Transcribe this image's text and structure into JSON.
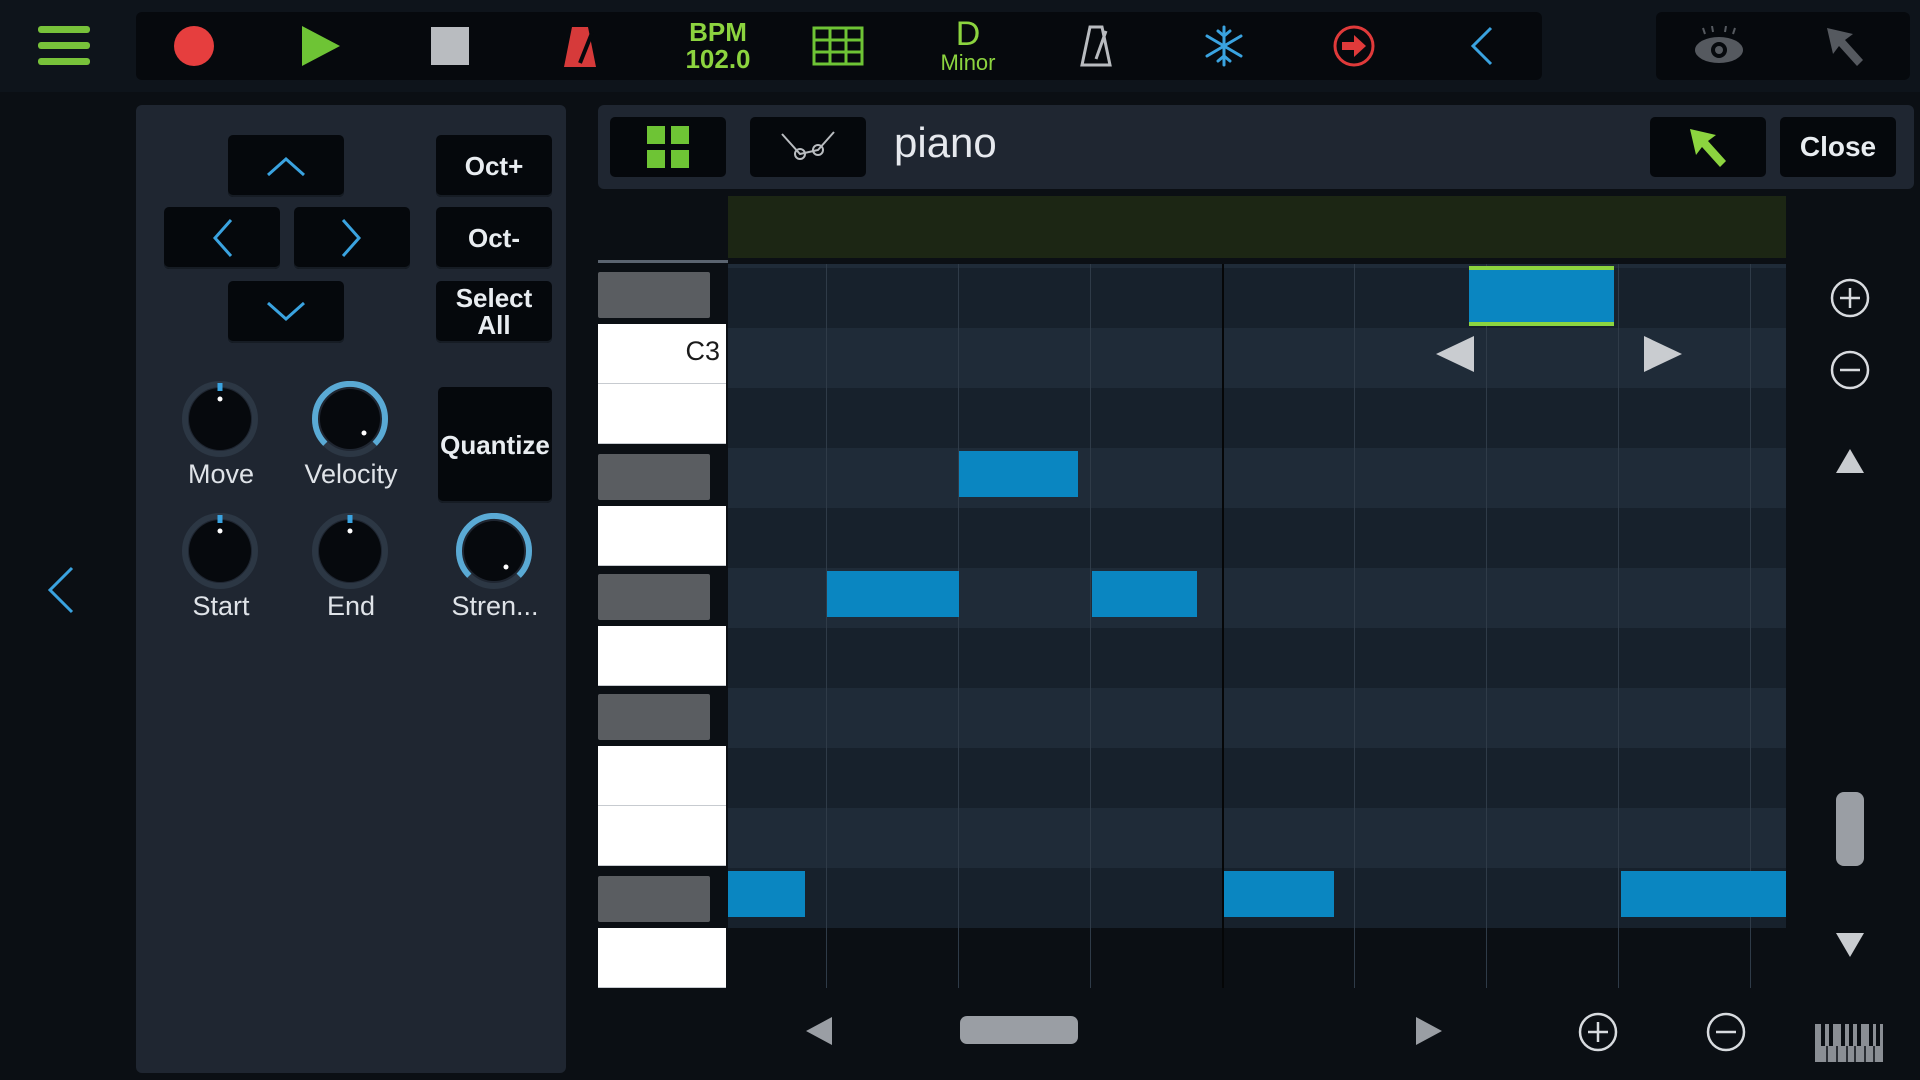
{
  "toolbar": {
    "bpm_label": "BPM",
    "bpm_value": "102.0",
    "key_root": "D",
    "key_mode": "Minor"
  },
  "edit_panel": {
    "oct_up": "Oct+",
    "oct_down": "Oct-",
    "select_all_line1": "Select",
    "select_all_line2": "All",
    "quantize": "Quantize",
    "knobs": {
      "move": "Move",
      "velocity": "Velocity",
      "start": "Start",
      "end": "End",
      "strength": "Stren..."
    }
  },
  "editor": {
    "instrument_name": "piano",
    "close_label": "Close",
    "note_label": "C3"
  },
  "colors": {
    "accent_green": "#8cd43f",
    "note_blue": "#0a86c1",
    "record_red": "#e63e3e",
    "icon_blue": "#3aa3e0"
  },
  "piano_roll": {
    "rows": 11,
    "notes": [
      {
        "row": 1,
        "start_beat": 5.6,
        "length_beats": 1.1,
        "selected": true
      },
      {
        "row": 4,
        "start_beat": 1.75,
        "length_beats": 0.9,
        "selected": false
      },
      {
        "row": 6,
        "start_beat": 0.75,
        "length_beats": 1.0,
        "selected": false
      },
      {
        "row": 6,
        "start_beat": 2.75,
        "length_beats": 0.8,
        "selected": false
      },
      {
        "row": 11,
        "start_beat": 0.0,
        "length_beats": 0.58,
        "selected": false
      },
      {
        "row": 11,
        "start_beat": 3.75,
        "length_beats": 0.83,
        "selected": false
      },
      {
        "row": 11,
        "start_beat": 6.75,
        "length_beats": 1.25,
        "selected": false
      }
    ]
  }
}
